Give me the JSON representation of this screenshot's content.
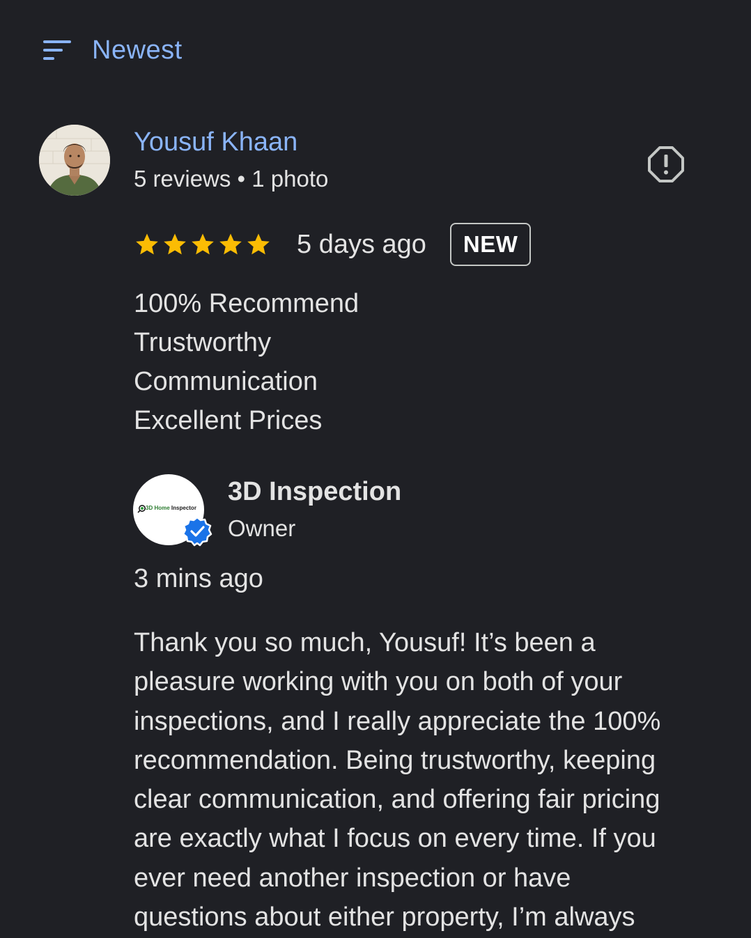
{
  "sort": {
    "icon": "sort-icon",
    "label": "Newest"
  },
  "review": {
    "avatar_icon": "profile-photo",
    "reviewer_name": "Yousuf Khaan",
    "reviewer_meta": "5 reviews • 1 photo",
    "report_icon": "report-icon",
    "rating": 5,
    "rating_max": 5,
    "date": "5 days ago",
    "badge": "NEW",
    "lines": [
      "100% Recommend",
      "Trustworthy",
      "Communication",
      "Excellent Prices"
    ]
  },
  "reply": {
    "owner_logo": {
      "brand": "3D Home",
      "rest": "Inspector"
    },
    "verified_icon": "verified-badge-icon",
    "owner_name": "3D Inspection",
    "owner_role": "Owner",
    "date": "3 mins ago",
    "lines": [
      "Thank you so much, Yousuf! It’s been a",
      "pleasure working with you on both of your",
      "inspections, and I really appreciate the 100%",
      "recommendation. Being trustworthy, keeping",
      "clear communication, and offering fair pricing",
      "are exactly what I focus on every time. If you",
      "ever need another inspection or have",
      "questions about either property, I’m always"
    ]
  },
  "colors": {
    "background": "#1f2025",
    "link_blue": "#8ab4f8",
    "star_yellow": "#fbbc04",
    "text": "#e3e3e3",
    "verified_blue": "#1a73e8"
  }
}
